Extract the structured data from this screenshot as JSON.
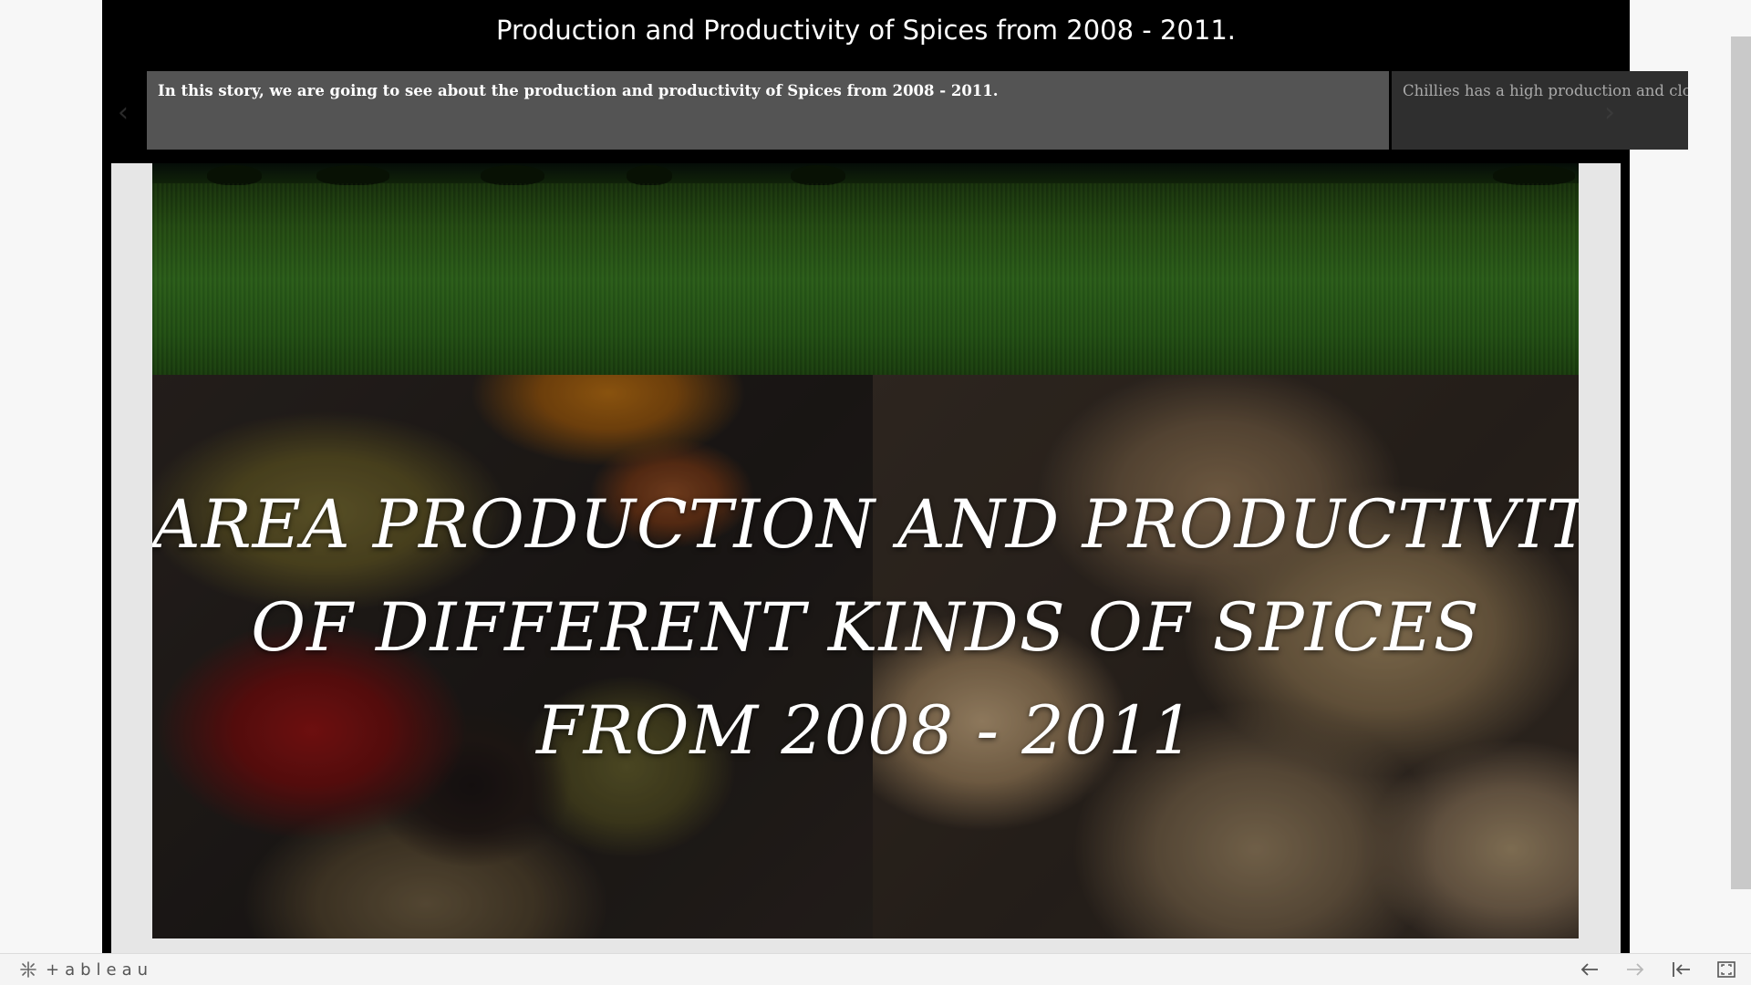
{
  "story": {
    "title": "Production and Productivity of Spices from 2008 - 2011.",
    "storypoints": [
      {
        "caption": "In this story, we are going to see about the production and productivity of Spices from 2008 - 2011.",
        "selected": true
      },
      {
        "caption": "Chillies has a high production and clove",
        "selected": false
      }
    ]
  },
  "dashboard": {
    "headline_lines": [
      "AREA PRODUCTION AND PRODUCTIVITY",
      "OF DIFFERENT KINDS OF SPICES",
      "FROM 2008 - 2011"
    ]
  },
  "toolbar": {
    "logo_text": "+ableau"
  },
  "icons": {
    "prev": "chevron-left-icon",
    "next": "chevron-right-icon",
    "undo": "arrow-left-icon",
    "redo": "arrow-right-icon",
    "revert": "revert-icon",
    "fullscreen": "fullscreen-icon"
  }
}
